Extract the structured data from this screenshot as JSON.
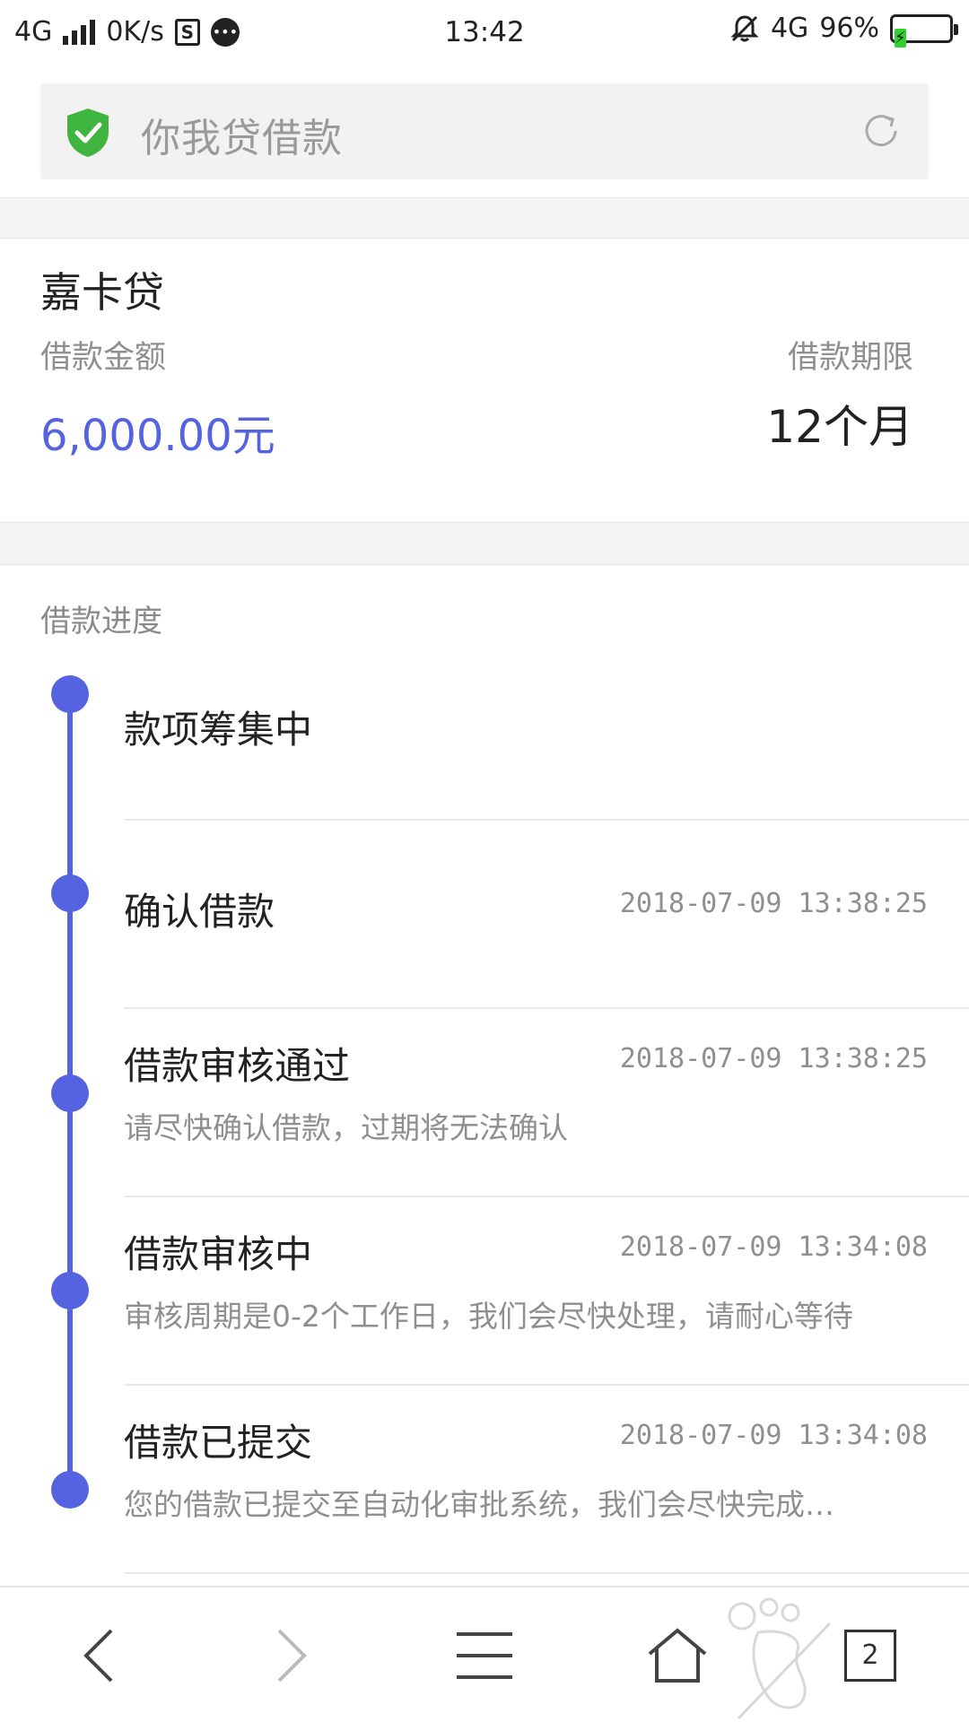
{
  "status_bar": {
    "network": "4G",
    "speed": "0K/s",
    "time": "13:42",
    "network_right": "4G",
    "battery": "96%",
    "battery_color": "#2fd12f"
  },
  "address_bar": {
    "title": "你我贷借款",
    "secure_icon": "shield-check-icon",
    "refresh_icon": "refresh-icon"
  },
  "loan": {
    "name": "嘉卡贷",
    "amount_label": "借款金额",
    "amount_value": "6,000.00元",
    "term_label": "借款期限",
    "term_value": "12个月",
    "accent_color": "#5563e0"
  },
  "progress": {
    "title": "借款进度",
    "steps": [
      {
        "title": "款项筹集中",
        "time": "",
        "desc": ""
      },
      {
        "title": "确认借款",
        "time": "2018-07-09 13:38:25",
        "desc": ""
      },
      {
        "title": "借款审核通过",
        "time": "2018-07-09 13:38:25",
        "desc": "请尽快确认借款，过期将无法确认"
      },
      {
        "title": "借款审核中",
        "time": "2018-07-09 13:34:08",
        "desc": "审核周期是0-2个工作日，我们会尽快处理，请耐心等待"
      },
      {
        "title": "借款已提交",
        "time": "2018-07-09 13:34:08",
        "desc": "您的借款已提交至自动化审批系统，我们会尽快完成…"
      }
    ]
  },
  "bottom_nav": {
    "tab_count": "2",
    "icons": [
      "back-icon",
      "forward-icon",
      "menu-icon",
      "home-icon",
      "tabs-icon"
    ]
  }
}
